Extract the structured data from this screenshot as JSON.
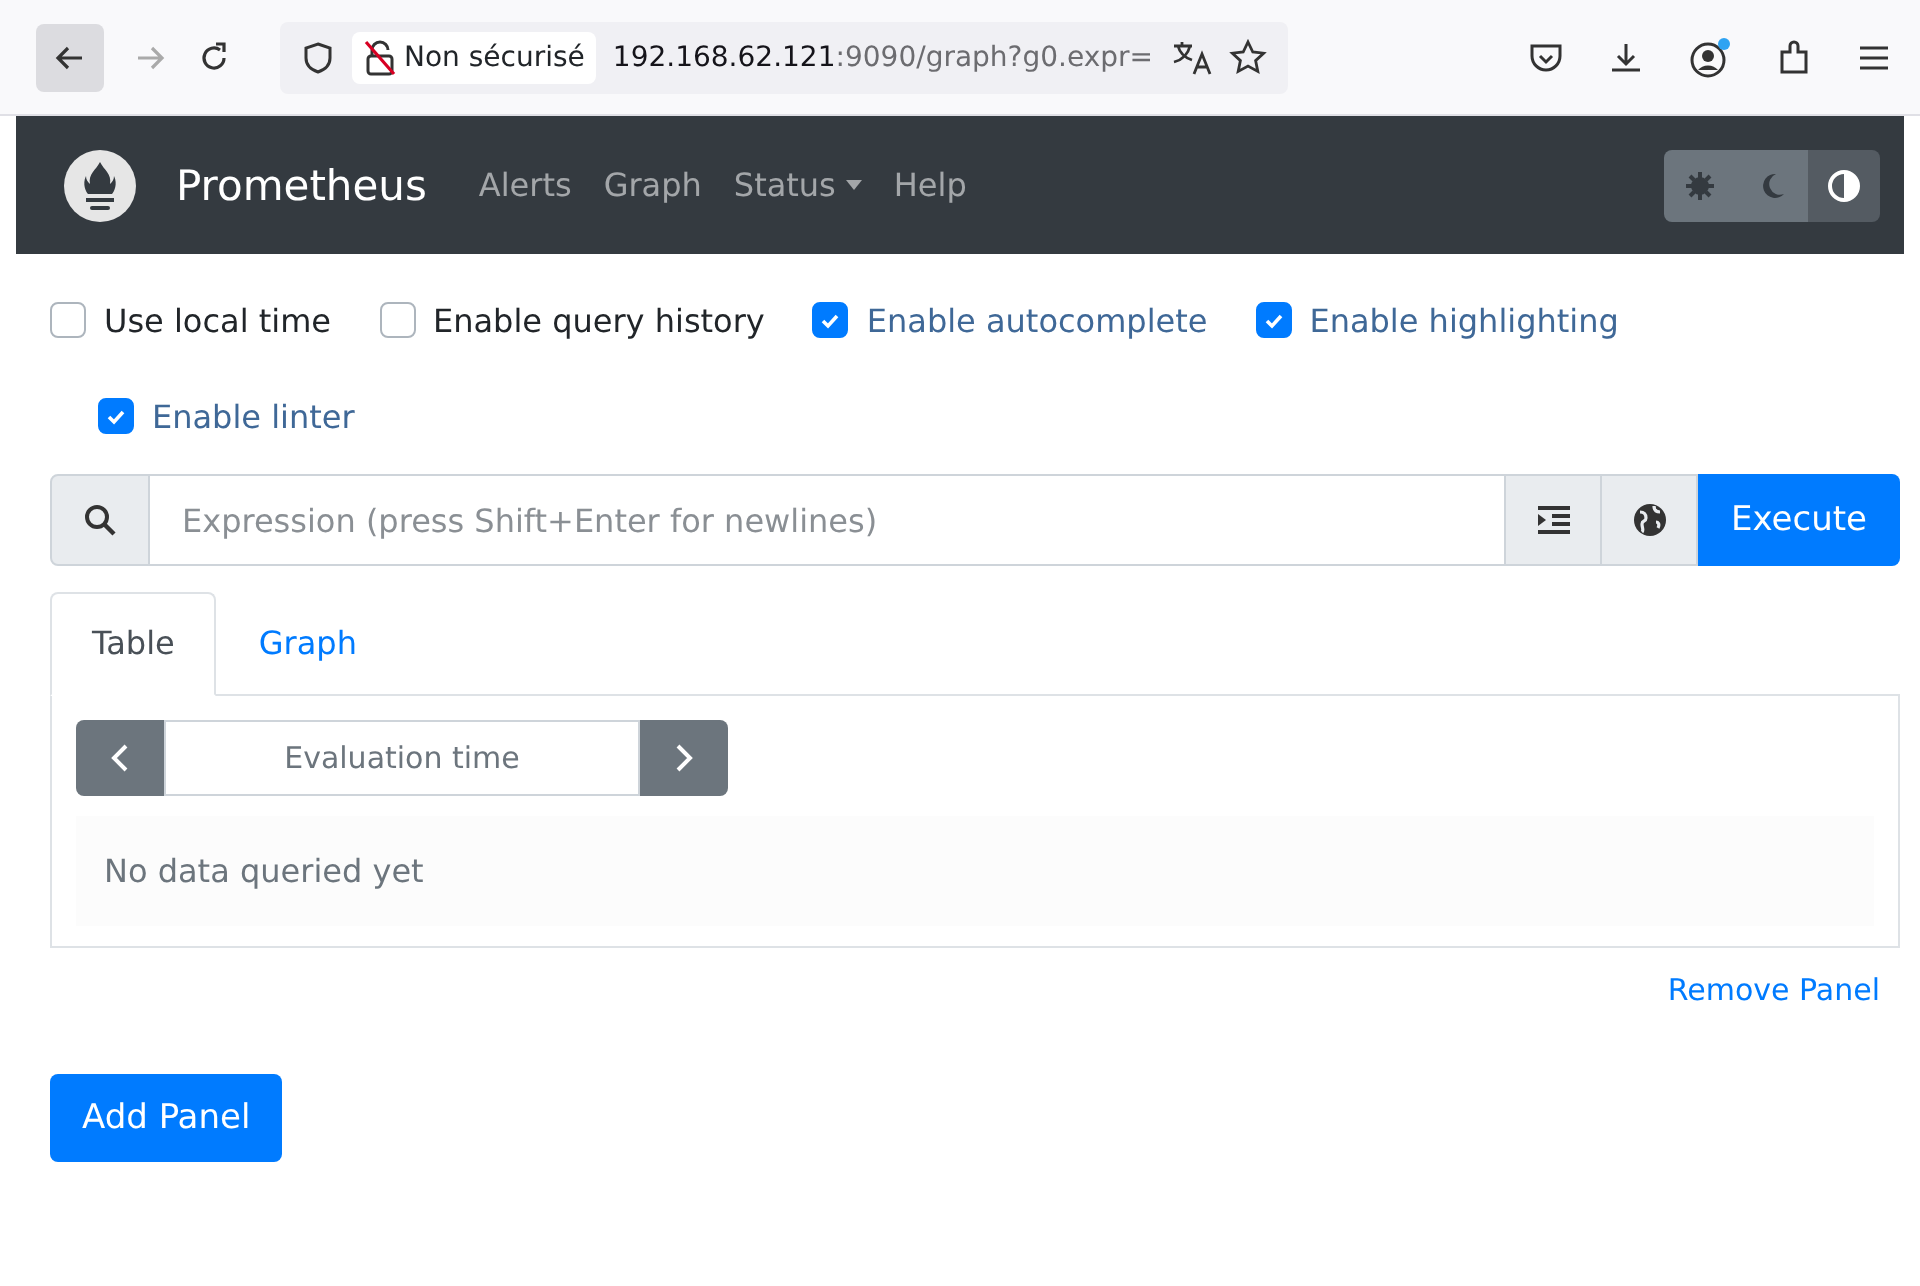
{
  "browser": {
    "address_security": "Non sécurisé",
    "url_host": "192.168.62.121",
    "url_rest": ":9090/graph?g0.expr="
  },
  "navbar": {
    "brand": "Prometheus",
    "links": [
      {
        "label": "Alerts",
        "dropdown": false
      },
      {
        "label": "Graph",
        "dropdown": false
      },
      {
        "label": "Status",
        "dropdown": true
      },
      {
        "label": "Help",
        "dropdown": false
      }
    ],
    "theme_buttons": [
      {
        "kind": "light",
        "selected": false
      },
      {
        "kind": "dark",
        "selected": false
      },
      {
        "kind": "auto",
        "selected": true
      }
    ]
  },
  "options": [
    {
      "label": "Use local time",
      "checked": false
    },
    {
      "label": "Enable query history",
      "checked": false
    },
    {
      "label": "Enable autocomplete",
      "checked": true
    },
    {
      "label": "Enable highlighting",
      "checked": true
    },
    {
      "label": "Enable linter",
      "checked": true
    }
  ],
  "query": {
    "placeholder": "Expression (press Shift+Enter for newlines)",
    "execute": "Execute"
  },
  "panel": {
    "tabs": [
      {
        "label": "Table",
        "selected": true
      },
      {
        "label": "Graph",
        "selected": false
      }
    ],
    "evaluation_time": {
      "placeholder": "Evaluation time"
    },
    "empty_message": "No data queried yet",
    "remove": "Remove Panel"
  },
  "add_panel": "Add Panel"
}
